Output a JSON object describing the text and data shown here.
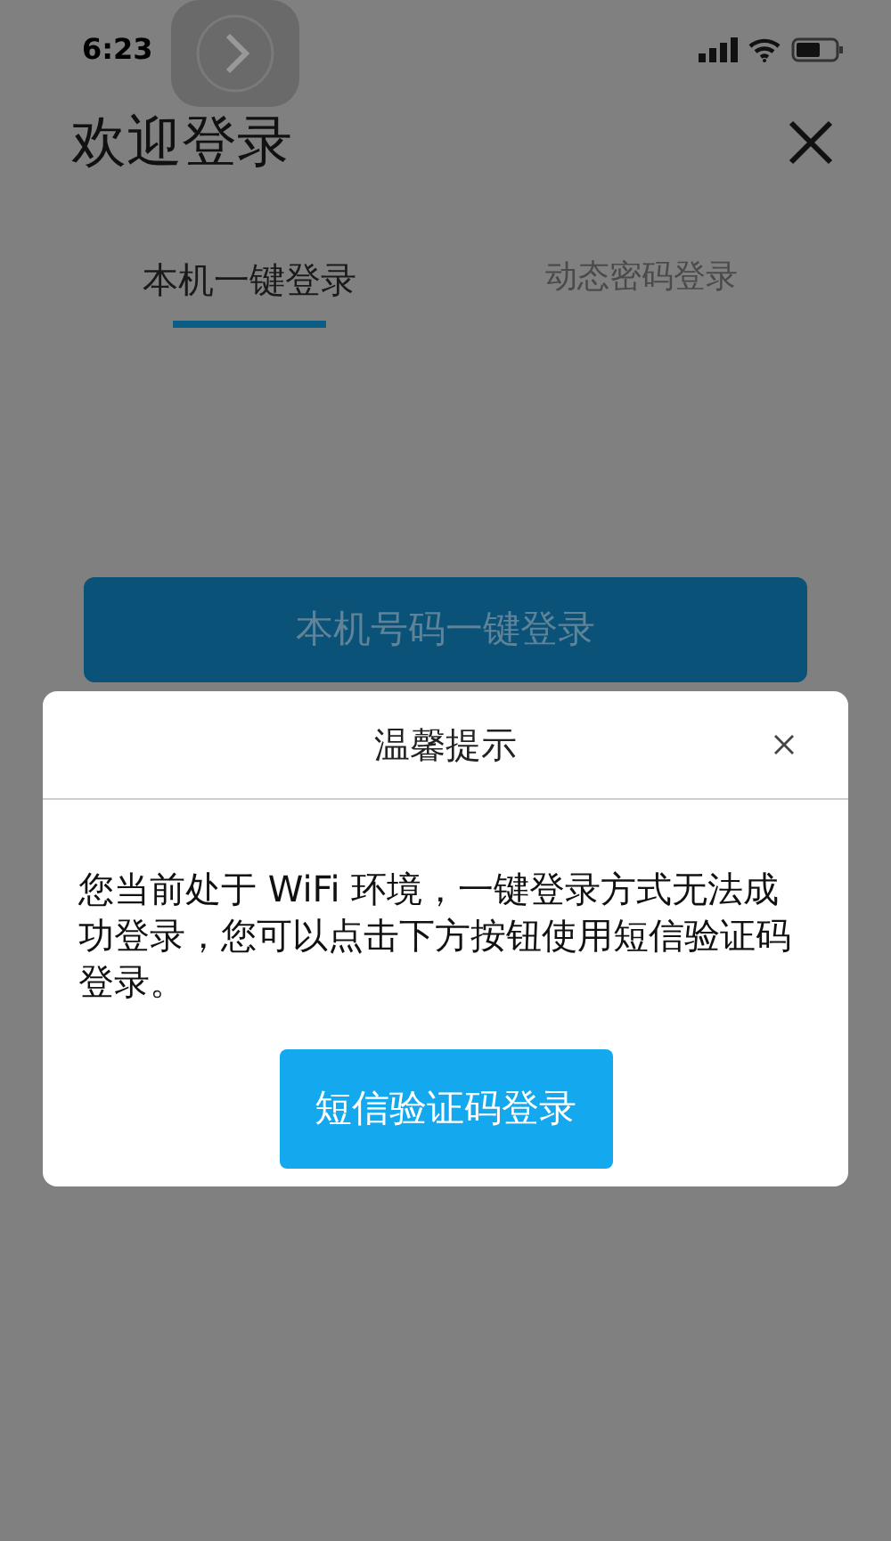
{
  "status_bar": {
    "time": "6:23"
  },
  "header": {
    "title": "欢迎登录"
  },
  "tabs": [
    {
      "label": "本机一键登录",
      "selected": true
    },
    {
      "label": "动态密码登录",
      "selected": false
    }
  ],
  "login_button": {
    "label": "本机号码一键登录"
  },
  "dialog": {
    "title": "温馨提示",
    "message": "您当前处于 WiFi 环境，一键登录方式无法成功登录，您可以点击下方按钮使用短信验证码登录。",
    "button": "短信验证码登录"
  }
}
